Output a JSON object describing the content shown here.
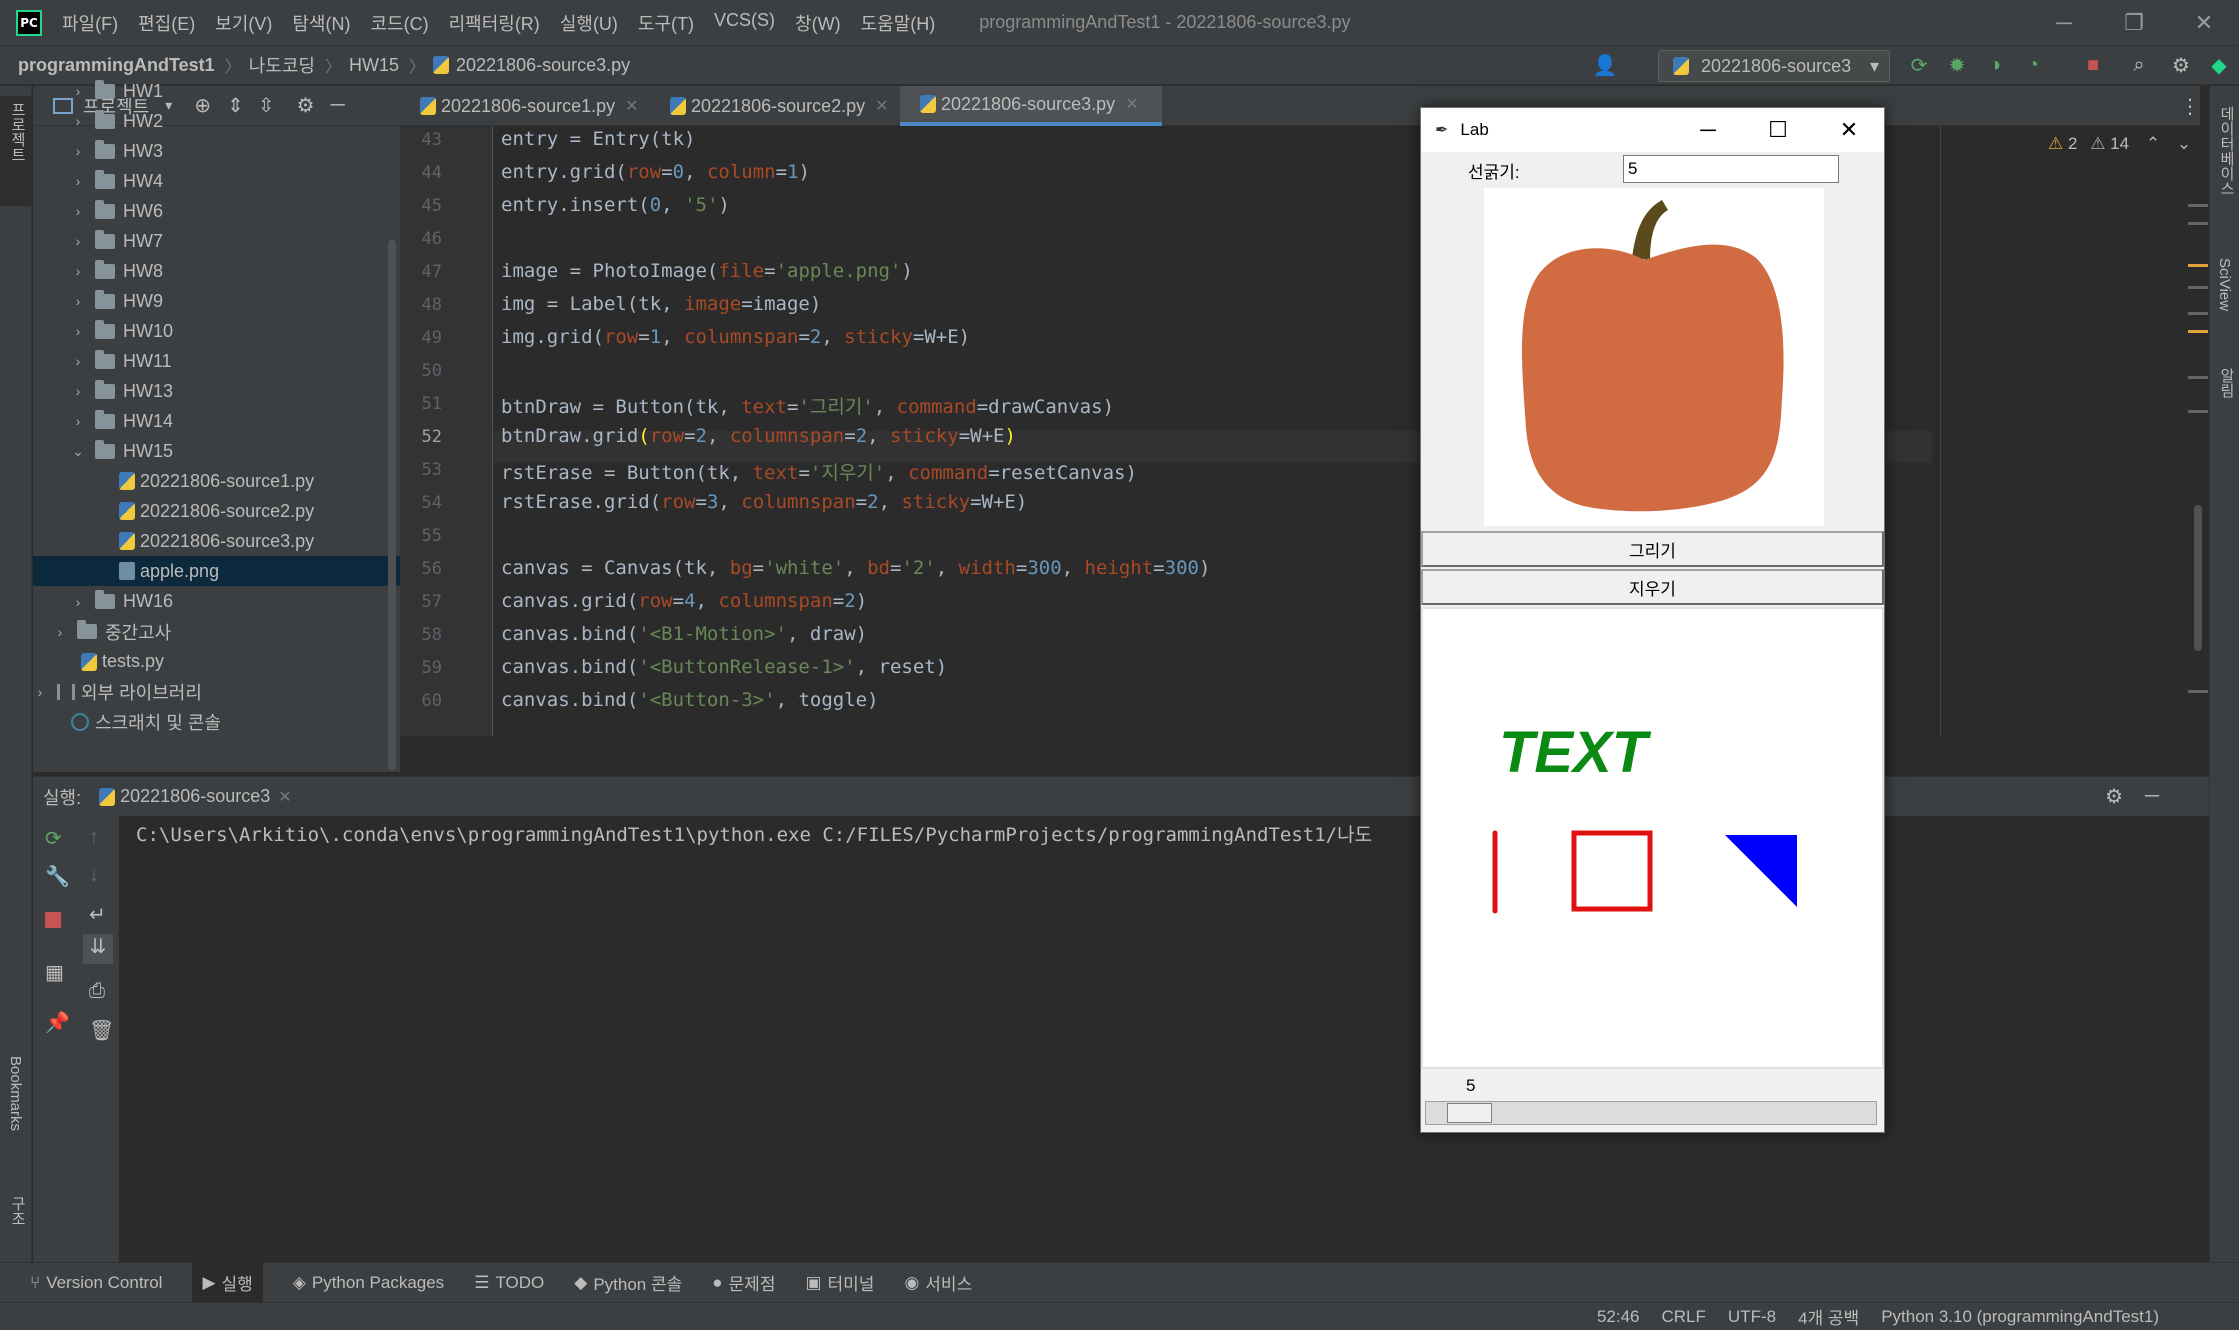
{
  "menubar": {
    "items": [
      "파일(F)",
      "편집(E)",
      "보기(V)",
      "탐색(N)",
      "코드(C)",
      "리팩터링(R)",
      "실행(U)",
      "도구(T)",
      "VCS(S)",
      "창(W)",
      "도움말(H)"
    ],
    "window_title": "programmingAndTest1 - 20221806-source3.py",
    "logo_text": "PC"
  },
  "breadcrumb": [
    "programmingAndTest1",
    "나도코딩",
    "HW15",
    "20221806-source3.py"
  ],
  "run_config": "20221806-source3",
  "project": {
    "header": "프로젝트",
    "rows": [
      {
        "indent": 1,
        "arrow": "›",
        "type": "folder",
        "label": "HW1"
      },
      {
        "indent": 1,
        "arrow": "›",
        "type": "folder",
        "label": "HW2"
      },
      {
        "indent": 1,
        "arrow": "›",
        "type": "folder",
        "label": "HW3"
      },
      {
        "indent": 1,
        "arrow": "›",
        "type": "folder",
        "label": "HW4"
      },
      {
        "indent": 1,
        "arrow": "›",
        "type": "folder",
        "label": "HW6"
      },
      {
        "indent": 1,
        "arrow": "›",
        "type": "folder",
        "label": "HW7"
      },
      {
        "indent": 1,
        "arrow": "›",
        "type": "folder",
        "label": "HW8"
      },
      {
        "indent": 1,
        "arrow": "›",
        "type": "folder",
        "label": "HW9"
      },
      {
        "indent": 1,
        "arrow": "›",
        "type": "folder",
        "label": "HW10"
      },
      {
        "indent": 1,
        "arrow": "›",
        "type": "folder",
        "label": "HW11"
      },
      {
        "indent": 1,
        "arrow": "›",
        "type": "folder",
        "label": "HW13"
      },
      {
        "indent": 1,
        "arrow": "›",
        "type": "folder",
        "label": "HW14"
      },
      {
        "indent": 1,
        "arrow": "⌄",
        "type": "folder",
        "label": "HW15"
      },
      {
        "indent": 2,
        "arrow": "",
        "type": "py",
        "label": "20221806-source1.py"
      },
      {
        "indent": 2,
        "arrow": "",
        "type": "py",
        "label": "20221806-source2.py"
      },
      {
        "indent": 2,
        "arrow": "",
        "type": "py",
        "label": "20221806-source3.py"
      },
      {
        "indent": 2,
        "arrow": "",
        "type": "img",
        "label": "apple.png",
        "selected": true
      },
      {
        "indent": 1,
        "arrow": "›",
        "type": "folder",
        "label": "HW16"
      },
      {
        "indent": 0,
        "arrow": "›",
        "type": "folder",
        "label": "중간고사"
      },
      {
        "indent": 0,
        "arrow": "",
        "type": "py",
        "label": "tests.py"
      },
      {
        "indent": -1,
        "arrow": "›",
        "type": "lib",
        "label": "외부 라이브러리"
      },
      {
        "indent": -1,
        "arrow": "",
        "type": "scratch",
        "label": "스크래치 및 콘솔"
      }
    ]
  },
  "tabs": [
    {
      "label": "20221806-source1.py",
      "active": false
    },
    {
      "label": "20221806-source2.py",
      "active": false
    },
    {
      "label": "20221806-source3.py",
      "active": true
    }
  ],
  "inspections": {
    "warnings": "2",
    "weak_warnings": "14"
  },
  "code": {
    "current_line": 52,
    "lines": [
      {
        "n": 43,
        "tokens": [
          [
            "id",
            "entry = Entry(tk)"
          ]
        ]
      },
      {
        "n": 44,
        "tokens": [
          [
            "id",
            "entry.grid("
          ],
          [
            "kw",
            "row"
          ],
          [
            "id",
            "="
          ],
          [
            "num",
            "0"
          ],
          [
            "id",
            ", "
          ],
          [
            "kw",
            "column"
          ],
          [
            "id",
            "="
          ],
          [
            "num",
            "1"
          ],
          [
            "id",
            ")"
          ]
        ]
      },
      {
        "n": 45,
        "tokens": [
          [
            "id",
            "entry.insert("
          ],
          [
            "num",
            "0"
          ],
          [
            "id",
            ", "
          ],
          [
            "str",
            "'5'"
          ],
          [
            "id",
            ")"
          ]
        ]
      },
      {
        "n": 46,
        "tokens": []
      },
      {
        "n": 47,
        "tokens": [
          [
            "id",
            "image = PhotoImage("
          ],
          [
            "kw",
            "file"
          ],
          [
            "id",
            "="
          ],
          [
            "str",
            "'apple.png'"
          ],
          [
            "id",
            ")"
          ]
        ]
      },
      {
        "n": 48,
        "tokens": [
          [
            "id",
            "img = Label(tk, "
          ],
          [
            "kw",
            "image"
          ],
          [
            "id",
            "=image)"
          ]
        ]
      },
      {
        "n": 49,
        "tokens": [
          [
            "id",
            "img.grid("
          ],
          [
            "kw",
            "row"
          ],
          [
            "id",
            "="
          ],
          [
            "num",
            "1"
          ],
          [
            "id",
            ", "
          ],
          [
            "kw",
            "columnspan"
          ],
          [
            "id",
            "="
          ],
          [
            "num",
            "2"
          ],
          [
            "id",
            ", "
          ],
          [
            "kw",
            "sticky"
          ],
          [
            "id",
            "=W+E)"
          ]
        ]
      },
      {
        "n": 50,
        "tokens": []
      },
      {
        "n": 51,
        "tokens": [
          [
            "id",
            "btnDraw = Button(tk, "
          ],
          [
            "kw",
            "text"
          ],
          [
            "id",
            "="
          ],
          [
            "str",
            "'그리기'"
          ],
          [
            "id",
            ", "
          ],
          [
            "kw",
            "command"
          ],
          [
            "id",
            "=drawCanvas)"
          ]
        ]
      },
      {
        "n": 52,
        "tokens": [
          [
            "id",
            "btnDraw.grid"
          ],
          [
            "hl",
            "("
          ],
          [
            "kw",
            "row"
          ],
          [
            "id",
            "="
          ],
          [
            "num",
            "2"
          ],
          [
            "id",
            ", "
          ],
          [
            "kw",
            "columnspan"
          ],
          [
            "id",
            "="
          ],
          [
            "num",
            "2"
          ],
          [
            "id",
            ", "
          ],
          [
            "kw",
            "sticky"
          ],
          [
            "id",
            "=W+E"
          ],
          [
            "hl",
            ")"
          ]
        ]
      },
      {
        "n": 53,
        "tokens": [
          [
            "id",
            "rstErase = Button(tk, "
          ],
          [
            "kw",
            "text"
          ],
          [
            "id",
            "="
          ],
          [
            "str",
            "'지우기'"
          ],
          [
            "id",
            ", "
          ],
          [
            "kw",
            "command"
          ],
          [
            "id",
            "=resetCanvas)"
          ]
        ]
      },
      {
        "n": 54,
        "tokens": [
          [
            "id",
            "rstErase.grid("
          ],
          [
            "kw",
            "row"
          ],
          [
            "id",
            "="
          ],
          [
            "num",
            "3"
          ],
          [
            "id",
            ", "
          ],
          [
            "kw",
            "columnspan"
          ],
          [
            "id",
            "="
          ],
          [
            "num",
            "2"
          ],
          [
            "id",
            ", "
          ],
          [
            "kw",
            "sticky"
          ],
          [
            "id",
            "=W+E)"
          ]
        ]
      },
      {
        "n": 55,
        "tokens": []
      },
      {
        "n": 56,
        "tokens": [
          [
            "id",
            "canvas = Canvas(tk, "
          ],
          [
            "kw",
            "bg"
          ],
          [
            "id",
            "="
          ],
          [
            "str",
            "'white'"
          ],
          [
            "id",
            ", "
          ],
          [
            "kw",
            "bd"
          ],
          [
            "id",
            "="
          ],
          [
            "str",
            "'2'"
          ],
          [
            "id",
            ", "
          ],
          [
            "kw",
            "width"
          ],
          [
            "id",
            "="
          ],
          [
            "num",
            "300"
          ],
          [
            "id",
            ", "
          ],
          [
            "kw",
            "height"
          ],
          [
            "id",
            "="
          ],
          [
            "num",
            "300"
          ],
          [
            "id",
            ")"
          ]
        ]
      },
      {
        "n": 57,
        "tokens": [
          [
            "id",
            "canvas.grid("
          ],
          [
            "kw",
            "row"
          ],
          [
            "id",
            "="
          ],
          [
            "num",
            "4"
          ],
          [
            "id",
            ", "
          ],
          [
            "kw",
            "columnspan"
          ],
          [
            "id",
            "="
          ],
          [
            "num",
            "2"
          ],
          [
            "id",
            ")"
          ]
        ]
      },
      {
        "n": 58,
        "tokens": [
          [
            "id",
            "canvas.bind("
          ],
          [
            "str",
            "'<B1-Motion>'"
          ],
          [
            "id",
            ", draw)"
          ]
        ]
      },
      {
        "n": 59,
        "tokens": [
          [
            "id",
            "canvas.bind("
          ],
          [
            "str",
            "'<ButtonRelease-1>'"
          ],
          [
            "id",
            ", reset)"
          ]
        ]
      },
      {
        "n": 60,
        "tokens": [
          [
            "id",
            "canvas.bind("
          ],
          [
            "str",
            "'<Button-3>'"
          ],
          [
            "id",
            ", toggle)"
          ]
        ]
      }
    ]
  },
  "colors": {
    "keyword_arg": "#aa4926",
    "string": "#6a8759",
    "number": "#6897bb",
    "identifier": "#a9b7c6",
    "bracket_highlight": "#ffef28",
    "accent": "#4a88c7"
  },
  "run_panel": {
    "label": "실행:",
    "tab": "20221806-source3",
    "console": "C:\\Users\\Arkitio\\.conda\\envs\\programmingAndTest1\\python.exe C:/FILES/PycharmProjects/programmingAndTest1/나도"
  },
  "tool_tabs": [
    "Version Control",
    "실행",
    "Python Packages",
    "TODO",
    "Python 콘솔",
    "문제점",
    "터미널",
    "서비스"
  ],
  "status": [
    "52:46",
    "CRLF",
    "UTF-8",
    "4개 공백",
    "Python 3.10 (programmingAndTest1)"
  ],
  "side_labels": {
    "left_top": "프로젝트",
    "left_bookmarks": "Bookmarks",
    "left_structure": "구조",
    "right_db": "데이터베이스",
    "right_sciview": "SciView",
    "right_notify": "알림"
  },
  "lab": {
    "title": "Lab",
    "entry_label": "선굵기:",
    "entry_value": "5",
    "draw_button": "그리기",
    "erase_button": "지우기",
    "canvas_text": "TEXT",
    "scale_value": "5",
    "scale_fraction": 0.05
  }
}
